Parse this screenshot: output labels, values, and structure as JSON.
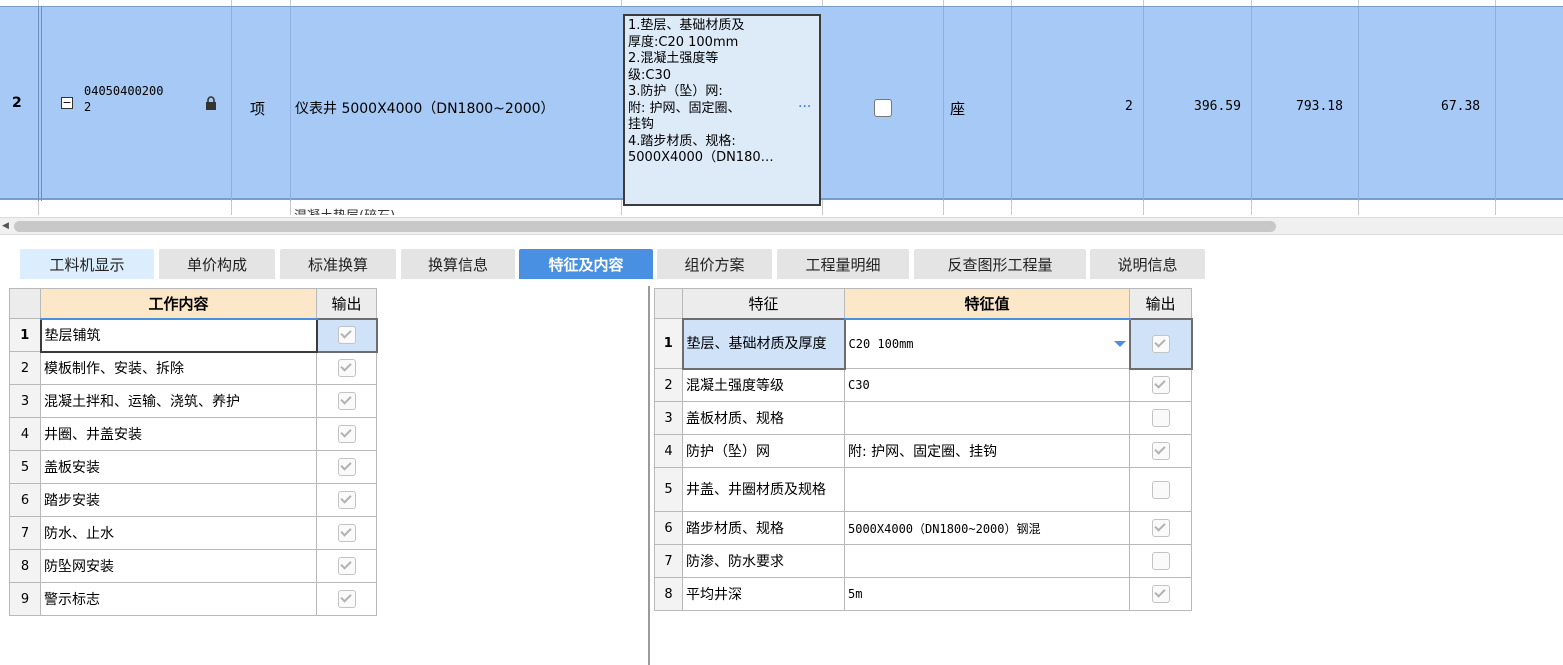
{
  "row": {
    "index": "2",
    "code_line1": "04050400200",
    "code_line2": "2",
    "type": "项",
    "name": "仪表井 5000X4000（DN1800~2000）",
    "features": "1.垫层、基础材质及\n厚度:C20 100mm\n2.混凝土强度等\n级:C30\n3.防护（坠）网:\n附: 护网、固定圈、\n挂钩\n4.踏步材质、规格:\n5000X4000（DN180…",
    "more": "···",
    "unit": "座",
    "qty": "2",
    "price": "396.59",
    "total": "793.18",
    "col_last": "67.38",
    "next_row_partial": "混凝土垫层(碎石)"
  },
  "tabs": [
    "工料机显示",
    "单价构成",
    "标准换算",
    "换算信息",
    "特征及内容",
    "组价方案",
    "工程量明细",
    "反查图形工程量",
    "说明信息"
  ],
  "active_tab": "特征及内容",
  "work": {
    "headers": {
      "content": "工作内容",
      "output": "输出"
    },
    "rows": [
      {
        "n": "1",
        "text": "垫层铺筑",
        "checked": true
      },
      {
        "n": "2",
        "text": "模板制作、安装、拆除",
        "checked": true
      },
      {
        "n": "3",
        "text": "混凝土拌和、运输、浇筑、养护",
        "checked": true
      },
      {
        "n": "4",
        "text": "井圈、井盖安装",
        "checked": true
      },
      {
        "n": "5",
        "text": "盖板安装",
        "checked": true
      },
      {
        "n": "6",
        "text": "踏步安装",
        "checked": true
      },
      {
        "n": "7",
        "text": "防水、止水",
        "checked": true
      },
      {
        "n": "8",
        "text": "防坠网安装",
        "checked": true
      },
      {
        "n": "9",
        "text": "警示标志",
        "checked": true
      }
    ]
  },
  "feat": {
    "headers": {
      "feature": "特征",
      "value": "特征值",
      "output": "输出"
    },
    "rows": [
      {
        "n": "1",
        "feature": "垫层、基础材质及厚度",
        "value": "C20 100mm",
        "checked": true
      },
      {
        "n": "2",
        "feature": "混凝土强度等级",
        "value": "C30",
        "checked": true
      },
      {
        "n": "3",
        "feature": "盖板材质、规格",
        "value": "",
        "checked": false
      },
      {
        "n": "4",
        "feature": "防护（坠）网",
        "value": "附: 护网、固定圈、挂钩",
        "checked": true
      },
      {
        "n": "5",
        "feature": "井盖、井圈材质及规格",
        "value": "",
        "checked": false
      },
      {
        "n": "6",
        "feature": "踏步材质、规格",
        "value": "5000X4000（DN1800~2000）钢混",
        "checked": true
      },
      {
        "n": "7",
        "feature": "防渗、防水要求",
        "value": "",
        "checked": false
      },
      {
        "n": "8",
        "feature": "平均井深",
        "value": "5m",
        "checked": true
      }
    ]
  }
}
